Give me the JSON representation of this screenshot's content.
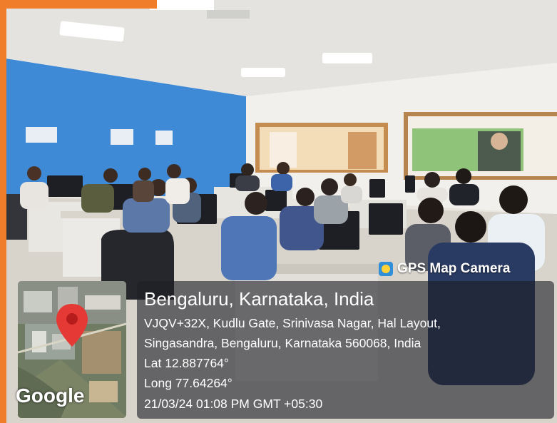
{
  "overlay": {
    "app_badge": "GPS Map Camera",
    "title": "Bengaluru, Karnataka, India",
    "address_line1": "VJQV+32X, Kudlu Gate, Srinivasa Nagar, Hal Layout,",
    "address_line2": "Singasandra, Bengaluru, Karnataka 560068, India",
    "lat": "Lat 12.887764°",
    "long": "Long 77.64264°",
    "datetime": "21/03/24 01:08 PM GMT +05:30",
    "map_attribution": "Google",
    "app_icon": "gps-map-camera-icon",
    "pin_icon": "map-pin-icon"
  },
  "colors": {
    "frame": "#ef7d2a",
    "wall_blue": "#3f8ad6",
    "pin": "#e53935"
  }
}
